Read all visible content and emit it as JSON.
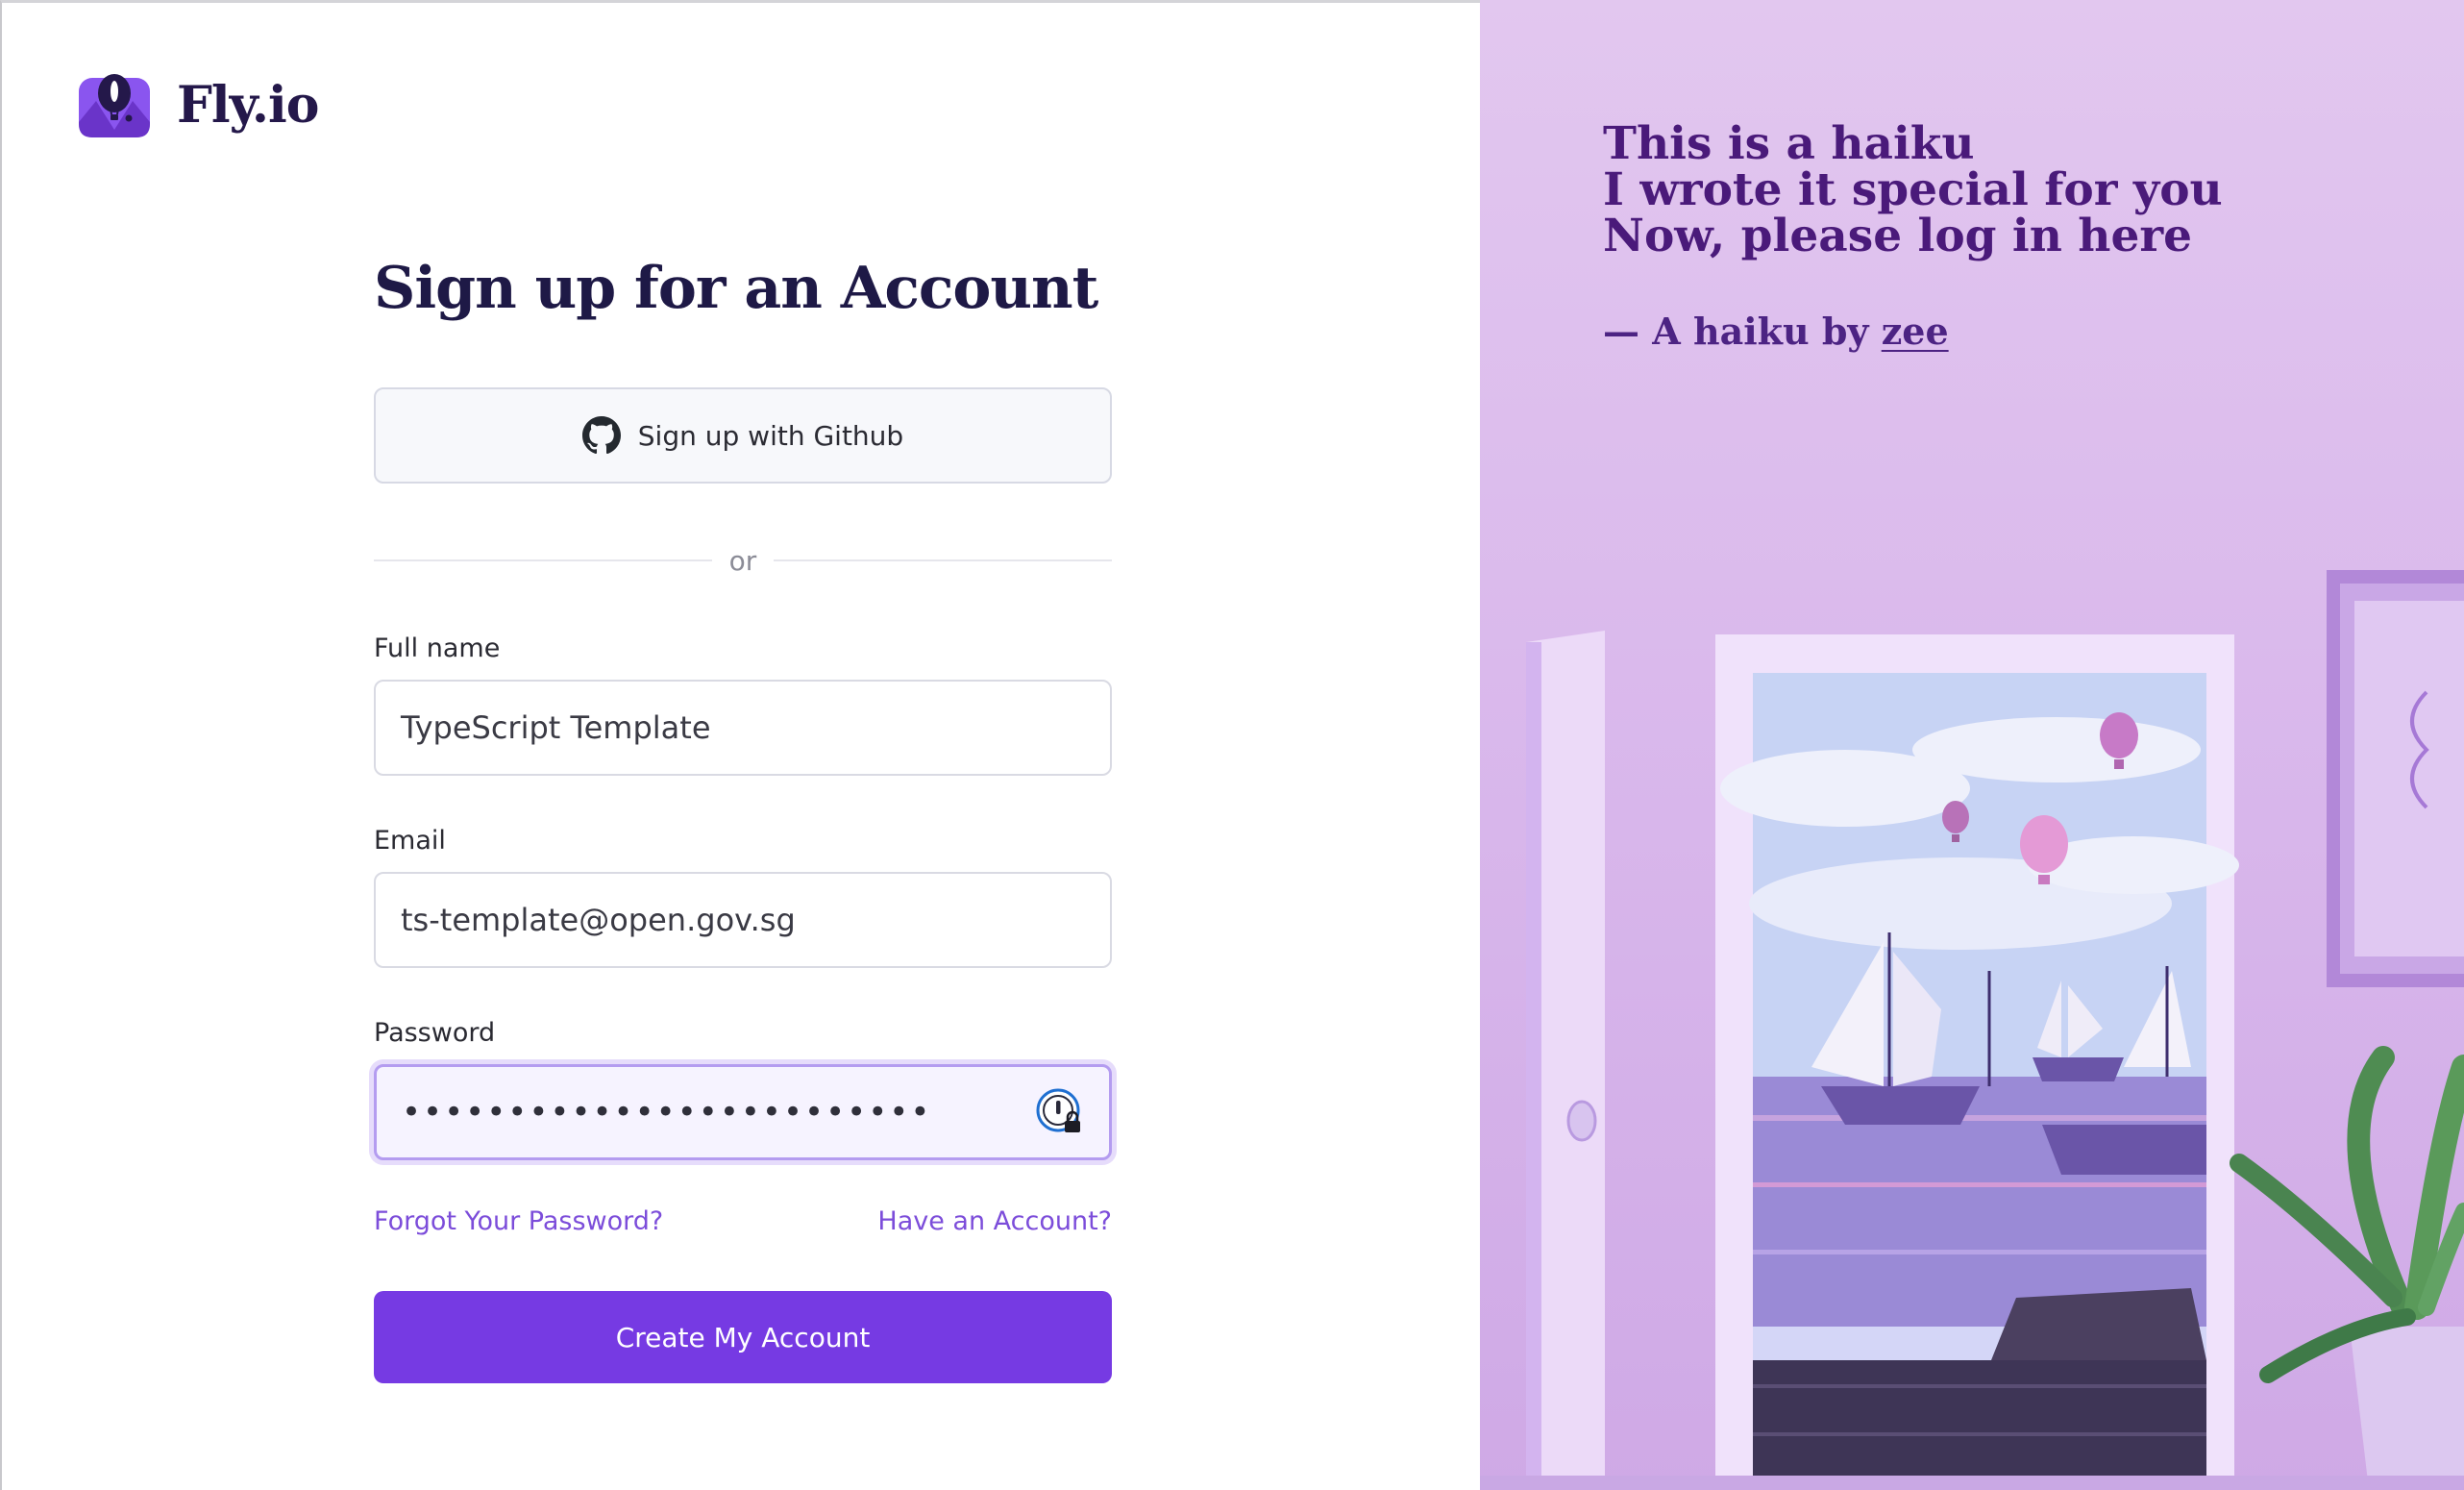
{
  "brand": {
    "name": "Fly.io",
    "accent": "#763ae3",
    "title_color": "#1e1946"
  },
  "signup": {
    "title": "Sign up for an Account",
    "github_label": "Sign up with Github",
    "divider_text": "or",
    "full_name": {
      "label": "Full name",
      "value": "TypeScript Template"
    },
    "email": {
      "label": "Email",
      "value": "ts-template@open.gov.sg"
    },
    "password": {
      "label": "Password",
      "value": "•••••••••••••••••••••••••"
    },
    "forgot_label": "Forgot Your Password?",
    "have_account_label": "Have an Account?",
    "submit_label": "Create My Account"
  },
  "haiku": {
    "lines": [
      "This is a haiku",
      "I wrote it special for you",
      "Now, please log in here"
    ],
    "byline_prefix": "— A haiku by ",
    "author": "zee"
  },
  "icons": {
    "logo": "flyio-balloon-logo-icon",
    "github": "github-icon",
    "password_manager": "password-manager-icon"
  }
}
